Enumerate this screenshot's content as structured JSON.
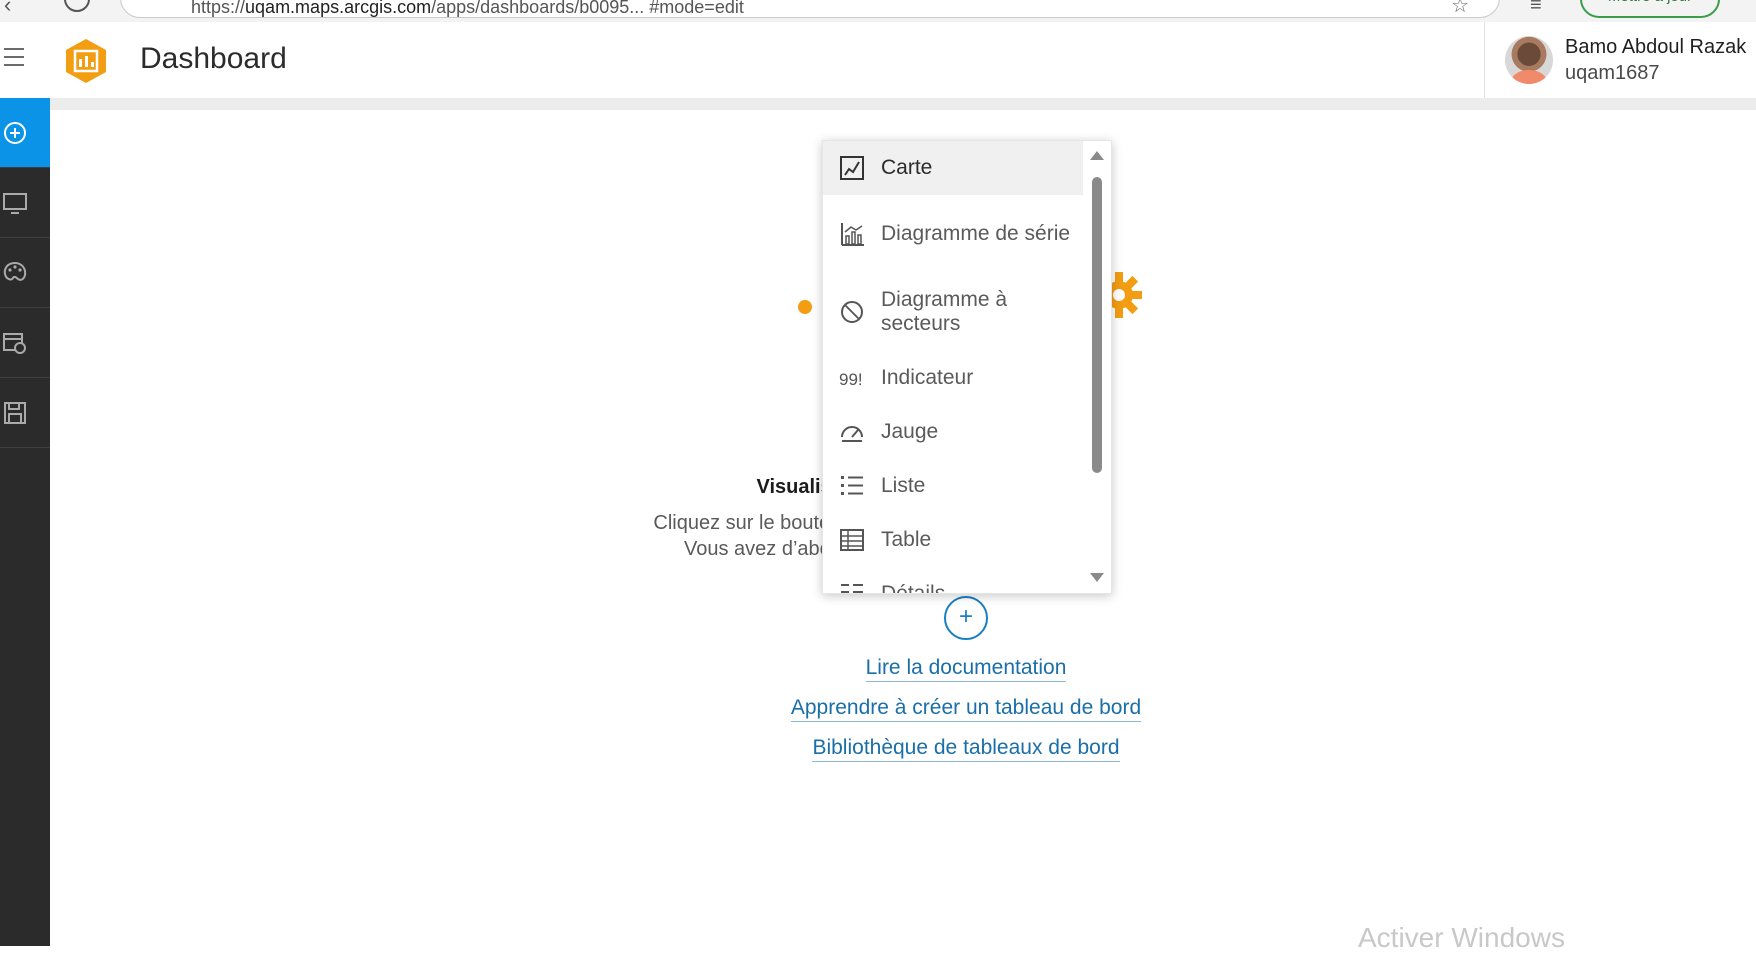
{
  "browser": {
    "url_prefix": "https://",
    "url_host": "uqam.maps.arcgis.com",
    "url_path": "/apps/dashboards/b0095... #mode=edit",
    "update_label": "Mettre à jour"
  },
  "header": {
    "title": "Dashboard",
    "user_name": "Bamo Abdoul Razak",
    "user_id": "uqam1687"
  },
  "rail": {
    "items": [
      "add-element",
      "layout",
      "theme",
      "settings",
      "save"
    ]
  },
  "dropdown": {
    "items": [
      {
        "label": "Carte",
        "icon": "map-icon",
        "selected": true
      },
      {
        "label": "Diagramme de série",
        "icon": "serial-chart-icon"
      },
      {
        "label": "Diagramme à secteurs",
        "icon": "pie-chart-icon"
      },
      {
        "label": "Indicateur",
        "icon": "indicator-icon"
      },
      {
        "label": "Jauge",
        "icon": "gauge-icon"
      },
      {
        "label": "Liste",
        "icon": "list-icon"
      },
      {
        "label": "Table",
        "icon": "table-icon"
      },
      {
        "label": "Détails",
        "icon": "details-icon"
      }
    ]
  },
  "empty_state": {
    "title": "Visualiser ... informations",
    "line1": "Cliquez sur le bouton ci- ... r votre tableau de bord.",
    "line2": "Vous avez d’abord b ... les liens ci-dessous."
  },
  "links": {
    "doc": "Lire la documentation",
    "learn": "Apprendre à créer un tableau de bord",
    "library": "Bibliothèque de tableaux de bord"
  },
  "watermark": "Activer Windows",
  "colors": {
    "accent": "#0b93e8",
    "rail": "#2b2b2b",
    "link": "#1a6fa8",
    "brand_orange": "#f29d12"
  }
}
